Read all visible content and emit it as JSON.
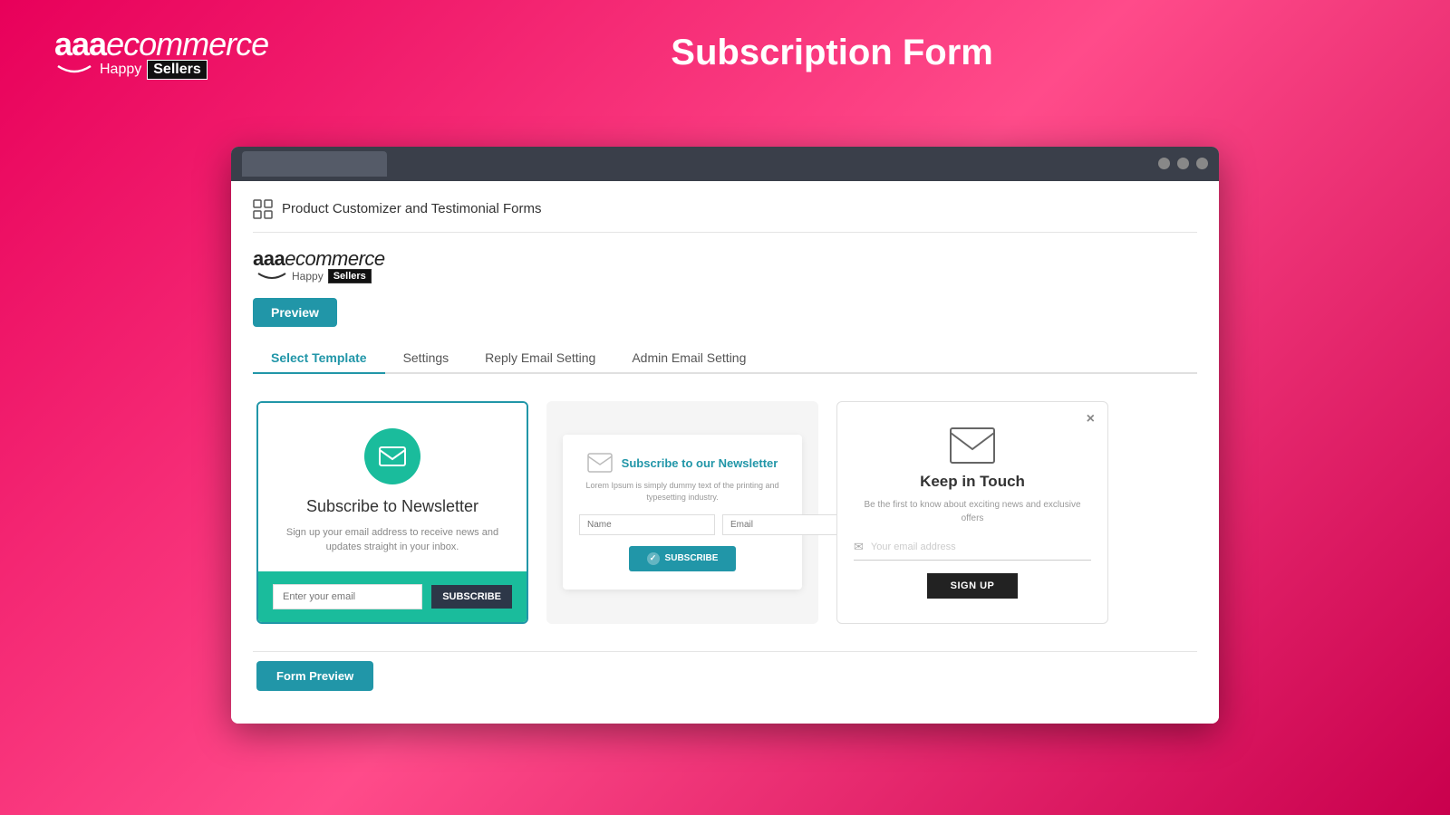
{
  "header": {
    "logo_aaa": "aaa",
    "logo_ecommerce": "ecommerce",
    "logo_happy": "Happy",
    "logo_sellers": "Sellers",
    "page_title": "Subscription Form"
  },
  "browser": {
    "dot1": "",
    "dot2": "",
    "dot3": ""
  },
  "app": {
    "header_icon": "grid-icon",
    "header_title": "Product Customizer and Testimonial Forms",
    "inner_logo_aaa": "aaa",
    "inner_logo_ecommerce": "ecommerce",
    "inner_logo_happy": "Happy",
    "inner_logo_sellers": "Sellers",
    "preview_button": "Preview",
    "tabs": [
      {
        "label": "Select Template",
        "active": true
      },
      {
        "label": "Settings",
        "active": false
      },
      {
        "label": "Reply Email Setting",
        "active": false
      },
      {
        "label": "Admin Email Setting",
        "active": false
      }
    ],
    "templates": [
      {
        "id": "template1",
        "title": "Subscribe to Newsletter",
        "description": "Sign up your email address to receive news and updates straight in your inbox.",
        "input_placeholder": "Enter your email",
        "button_label": "SUBSCRIBE",
        "selected": true
      },
      {
        "id": "template2",
        "title": "Subscribe to our Newsletter",
        "description": "Lorem Ipsum is simply dummy text of the printing and typesetting industry.",
        "name_placeholder": "Name",
        "email_placeholder": "Email",
        "button_label": "SUBSCRIBE",
        "selected": false
      },
      {
        "id": "template3",
        "title": "Keep in Touch",
        "description": "Be the first to know about exciting news and exclusive offers",
        "email_placeholder": "Your email address",
        "button_label": "SIGN UP",
        "close_icon": "×",
        "selected": false
      }
    ],
    "form_preview_button": "Form Preview"
  }
}
